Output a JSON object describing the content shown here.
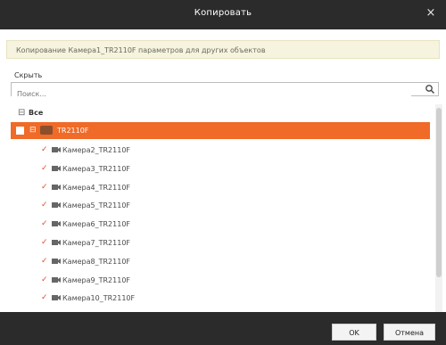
{
  "dialog": {
    "title": "Копировать",
    "close_glyph": "×"
  },
  "banner": {
    "text": "Копирование Камера1_TR2110F параметров для других объектов"
  },
  "search": {
    "label": "Скрыть",
    "placeholder": "Поиск..."
  },
  "tree": {
    "root_label": "Все",
    "root_expander": "⊟",
    "device": {
      "label": "TR2110F",
      "expander": "⊟",
      "checked": true
    },
    "cameras": [
      {
        "label": "Камера2_TR2110F",
        "checked": true
      },
      {
        "label": "Камера3_TR2110F",
        "checked": true
      },
      {
        "label": "Камера4_TR2110F",
        "checked": true
      },
      {
        "label": "Камера5_TR2110F",
        "checked": true
      },
      {
        "label": "Камера6_TR2110F",
        "checked": true
      },
      {
        "label": "Камера7_TR2110F",
        "checked": true
      },
      {
        "label": "Камера8_TR2110F",
        "checked": true
      },
      {
        "label": "Камера9_TR2110F",
        "checked": true
      },
      {
        "label": "Камера10_TR2110F",
        "checked": true
      }
    ]
  },
  "footer": {
    "ok_label": "OK",
    "cancel_label": "Отмена"
  },
  "colors": {
    "accent": "#f06a28",
    "titlebar": "#2b2b2b",
    "check": "#e04b2c"
  },
  "icons": {
    "search": "search-icon",
    "camera": "camera-icon",
    "device": "device-icon"
  }
}
